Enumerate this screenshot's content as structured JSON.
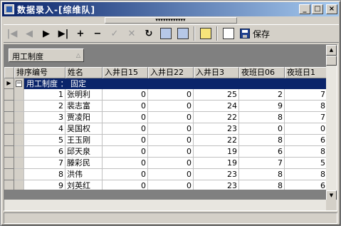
{
  "window": {
    "title": "数据录入-[综维队]"
  },
  "titlebar_buttons": {
    "minimize": "_",
    "maximize": "□",
    "close": "×"
  },
  "menustrip": {
    "grip": "▾▾▾▾▾▾▾▾▾▾▾▾"
  },
  "toolbar": {
    "first": "|◀",
    "prev": "◀",
    "next": "▶",
    "last": "▶|",
    "add": "+",
    "remove": "−",
    "confirm": "✓",
    "cancel": "✕",
    "refresh": "↻",
    "save_label": "保存"
  },
  "groupby": {
    "chip_label": "用工制度"
  },
  "grid": {
    "columns": [
      "排序编号",
      "姓名",
      "入井日15",
      "入井日22",
      "入井日3",
      "夜班日06",
      "夜班日1"
    ],
    "group_label": "用工制度 ： 固定",
    "rows": [
      {
        "no": "1",
        "name": "张明利",
        "v15": "0",
        "v22": "0",
        "v3": "25",
        "n06": "2",
        "n1": "7"
      },
      {
        "no": "2",
        "name": "裴志富",
        "v15": "0",
        "v22": "0",
        "v3": "24",
        "n06": "9",
        "n1": "8"
      },
      {
        "no": "3",
        "name": "贾凌阳",
        "v15": "0",
        "v22": "0",
        "v3": "22",
        "n06": "8",
        "n1": "7"
      },
      {
        "no": "4",
        "name": "吴国权",
        "v15": "0",
        "v22": "0",
        "v3": "23",
        "n06": "0",
        "n1": "0"
      },
      {
        "no": "5",
        "name": "王玉刚",
        "v15": "0",
        "v22": "0",
        "v3": "22",
        "n06": "8",
        "n1": "6"
      },
      {
        "no": "6",
        "name": "邱天泉",
        "v15": "0",
        "v22": "0",
        "v3": "19",
        "n06": "6",
        "n1": "8"
      },
      {
        "no": "7",
        "name": "滕彩民",
        "v15": "0",
        "v22": "0",
        "v3": "19",
        "n06": "7",
        "n1": "5"
      },
      {
        "no": "8",
        "name": "洪伟",
        "v15": "0",
        "v22": "0",
        "v3": "23",
        "n06": "8",
        "n1": "8"
      },
      {
        "no": "9",
        "name": "刘英红",
        "v15": "0",
        "v22": "0",
        "v3": "23",
        "n06": "8",
        "n1": "6"
      }
    ]
  }
}
